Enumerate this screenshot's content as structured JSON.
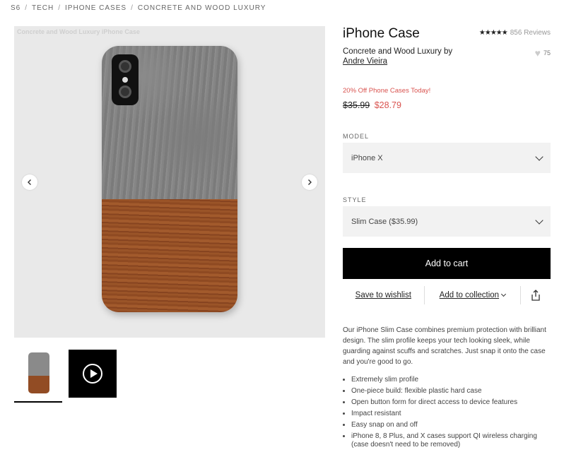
{
  "breadcrumb": [
    "S6",
    "TECH",
    "IPHONE CASES",
    "CONCRETE AND WOOD LUXURY"
  ],
  "gallery": {
    "caption": "Concrete and Wood Luxury iPhone Case"
  },
  "product": {
    "title": "iPhone Case",
    "rating_stars": "★★★★★",
    "reviews": "856 Reviews",
    "subtitle_line": "Concrete and Wood Luxury by",
    "artist": "Andre Vieira",
    "likes": "75",
    "promo": "20% Off Phone Cases Today!",
    "old_price": "$35.99",
    "new_price": "$28.79"
  },
  "model": {
    "label": "MODEL",
    "value": "iPhone X"
  },
  "style": {
    "label": "STYLE",
    "value": "Slim Case ($35.99)"
  },
  "actions": {
    "add_to_cart": "Add to cart",
    "save_to_wishlist": "Save to wishlist",
    "add_to_collection": "Add to collection"
  },
  "description": "Our iPhone Slim Case combines premium protection with brilliant design. The slim profile keeps your tech looking sleek, while guarding against scuffs and scratches. Just snap it onto the case and you're good to go.",
  "features": [
    "Extremely slim profile",
    "One-piece build: flexible plastic hard case",
    "Open button form for direct access to device features",
    "Impact resistant",
    "Easy snap on and off",
    "iPhone 8, 8 Plus, and X cases support QI wireless charging (case doesn't need to be removed)"
  ],
  "colors": {
    "sale": "#d9534f",
    "cart_bg": "#000000"
  }
}
